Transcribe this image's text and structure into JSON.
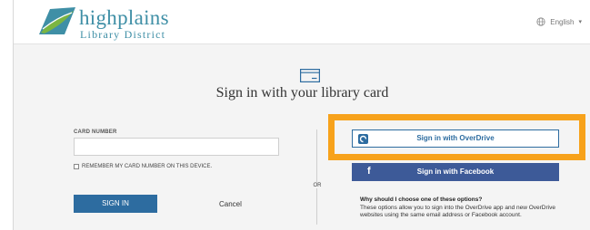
{
  "header": {
    "logo_word": "highplains",
    "logo_subtitle": "Library District",
    "language": "English",
    "icons": {
      "logo": "library-logo-mark",
      "globe": "globe-icon",
      "chevron": "chevron-down-icon"
    }
  },
  "main": {
    "card_icon": "library-card-icon",
    "title": "Sign in with your library card"
  },
  "form": {
    "card_label": "CARD NUMBER",
    "card_value": "",
    "remember_label": "REMEMBER MY CARD NUMBER ON THIS DEVICE.",
    "remember_checked": false,
    "signin_label": "SIGN IN",
    "cancel_label": "Cancel"
  },
  "divider": {
    "or_label": "OR"
  },
  "alt": {
    "overdrive_label": "Sign in with OverDrive",
    "facebook_label": "Sign in with Facebook",
    "why_question": "Why should I choose one of these options?",
    "why_answer": "These options allow you to sign into the OverDrive app and new OverDrive websites using the same email address or Facebook account."
  },
  "colors": {
    "accent_blue": "#2d6ca0",
    "facebook_blue": "#3d5a98",
    "highlight_orange": "#f7a21b",
    "logo_teal": "#3f8fa6",
    "logo_green": "#7bb542"
  }
}
